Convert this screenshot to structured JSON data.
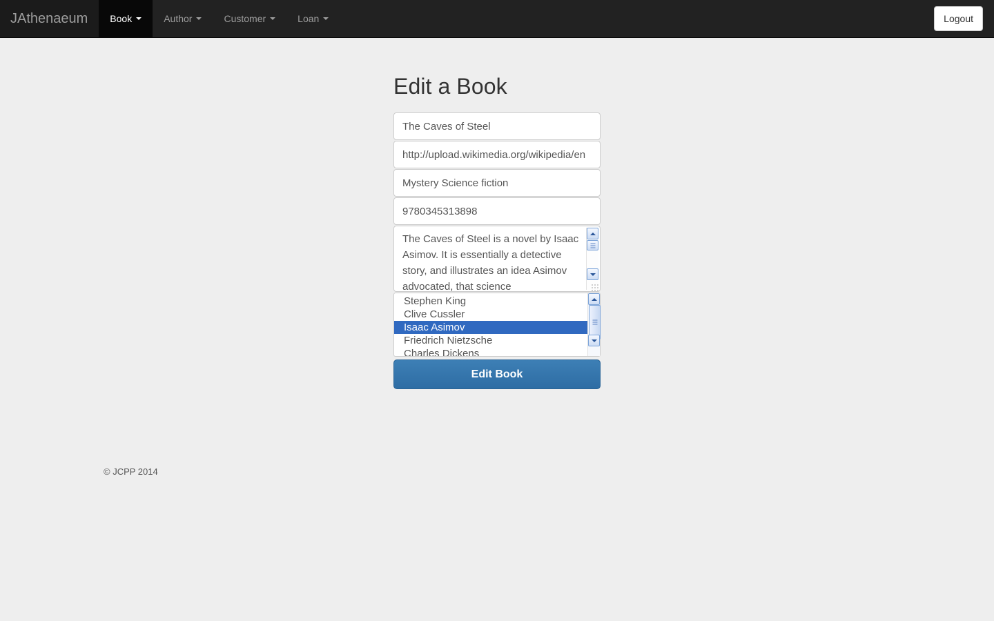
{
  "navbar": {
    "brand": "JAthenaeum",
    "items": [
      {
        "label": "Book",
        "icon": "chevron-down-icon",
        "active": true
      },
      {
        "label": "Author",
        "icon": "chevron-down-icon",
        "active": false
      },
      {
        "label": "Customer",
        "icon": "chevron-down-icon",
        "active": false
      },
      {
        "label": "Loan",
        "icon": "chevron-down-icon",
        "active": false
      }
    ],
    "logout_label": "Logout",
    "background_color": "#222222",
    "active_background_color": "#080808",
    "link_color": "#9d9d9d"
  },
  "main": {
    "title": "Edit a Book",
    "fields": {
      "title_value": "The Caves of Steel",
      "cover_url_value": "http://upload.wikimedia.org/wikipedia/en",
      "genre_value": "Mystery Science fiction",
      "isbn_value": "9780345313898",
      "description_value": "The Caves of Steel is a novel by Isaac Asimov. It is essentially a detective story, and illustrates an idea Asimov advocated, that science"
    },
    "authors": [
      {
        "name": "Stephen King",
        "selected": false
      },
      {
        "name": "Clive Cussler",
        "selected": false
      },
      {
        "name": "Isaac Asimov",
        "selected": true
      },
      {
        "name": "Friedrich Nietzsche",
        "selected": false
      },
      {
        "name": "Charles Dickens",
        "selected": false
      }
    ],
    "submit_label": "Edit Book",
    "submit_color": "#2e6da4",
    "selection_color": "#3069c0"
  },
  "footer": {
    "copyright": "© JCPP 2014"
  }
}
